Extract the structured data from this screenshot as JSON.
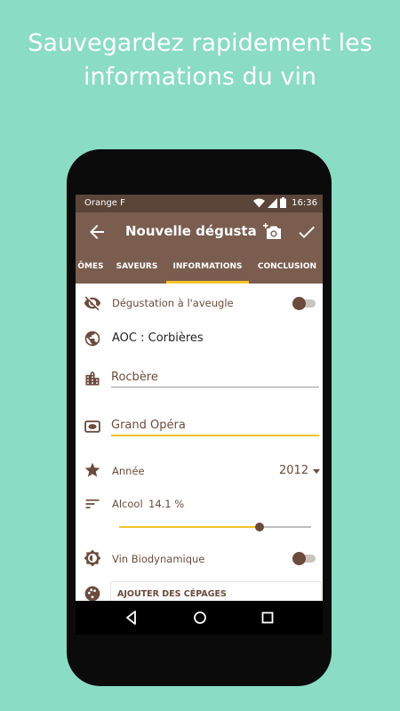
{
  "headline": {
    "line1": "Sauvegardez rapidement les",
    "line2": "informations du vin"
  },
  "status_bar": {
    "carrier": "Orange F",
    "time": "16:36",
    "icons": [
      "wifi-icon",
      "signal-icon",
      "battery-icon"
    ]
  },
  "app_bar": {
    "title": "Nouvelle dégustation",
    "icons": [
      "back-arrow-icon",
      "add-photo-icon",
      "check-icon"
    ]
  },
  "tabs": [
    {
      "label": "ÔMES",
      "active": false
    },
    {
      "label": "SAVEURS",
      "active": false
    },
    {
      "label": "INFORMATIONS",
      "active": true
    },
    {
      "label": "CONCLUSION",
      "active": false
    }
  ],
  "form": {
    "blind_tasting": {
      "label": "Dégustation à l'aveugle",
      "on": false
    },
    "appellation": {
      "value": "AOC : Corbières"
    },
    "producer": {
      "value": "Rocbère"
    },
    "wine_name": {
      "value": "Grand Opéra"
    },
    "year": {
      "label": "Année",
      "value": "2012"
    },
    "alcohol": {
      "label": "Alcool",
      "value": "14.1 %",
      "slider_fraction": 0.73
    },
    "biodynamic": {
      "label": "Vin Biodynamique",
      "on": false
    },
    "grapes": {
      "title": "AJOUTER DES CÉPAGES"
    }
  },
  "colors": {
    "background": "#8adcc3",
    "app_bar": "#7a5d4f",
    "status_bar": "#5b4539",
    "accent": "#f2c428",
    "brown_text": "#6b4b3c"
  },
  "nav_bar": {
    "icons": [
      "back-triangle-icon",
      "home-circle-icon",
      "recents-square-icon"
    ]
  }
}
